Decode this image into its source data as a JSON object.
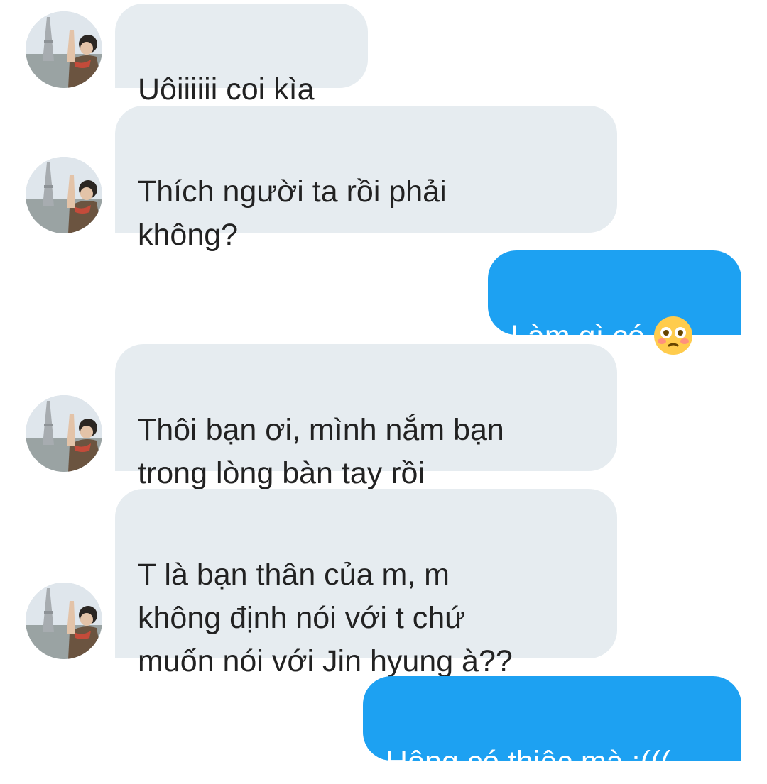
{
  "conversation": {
    "messages": [
      {
        "direction": "incoming",
        "text": "Uôiiiiii coi kìa"
      },
      {
        "direction": "incoming",
        "text": "Thích người ta rồi phải\nkhông?"
      },
      {
        "direction": "outgoing",
        "text": "Làm gì có",
        "emoji": "flushed-face-emoji"
      },
      {
        "direction": "incoming",
        "text": "Thôi bạn ơi, mình nắm bạn\ntrong lòng bàn tay rồi"
      },
      {
        "direction": "incoming",
        "text": "T là bạn thân của m, m\nkhông định nói với t chứ\nmuốn nói với Jin hyung à??"
      },
      {
        "direction": "outgoing",
        "text": "Hông có thiệc mà :((("
      }
    ]
  },
  "colors": {
    "incoming_bubble": "#e6ecf0",
    "outgoing_bubble": "#1da1f2",
    "incoming_text": "#222222",
    "outgoing_text": "#ffffff"
  },
  "icons": {
    "avatar": "contact-avatar-photo",
    "emoji": "flushed-face-emoji"
  }
}
